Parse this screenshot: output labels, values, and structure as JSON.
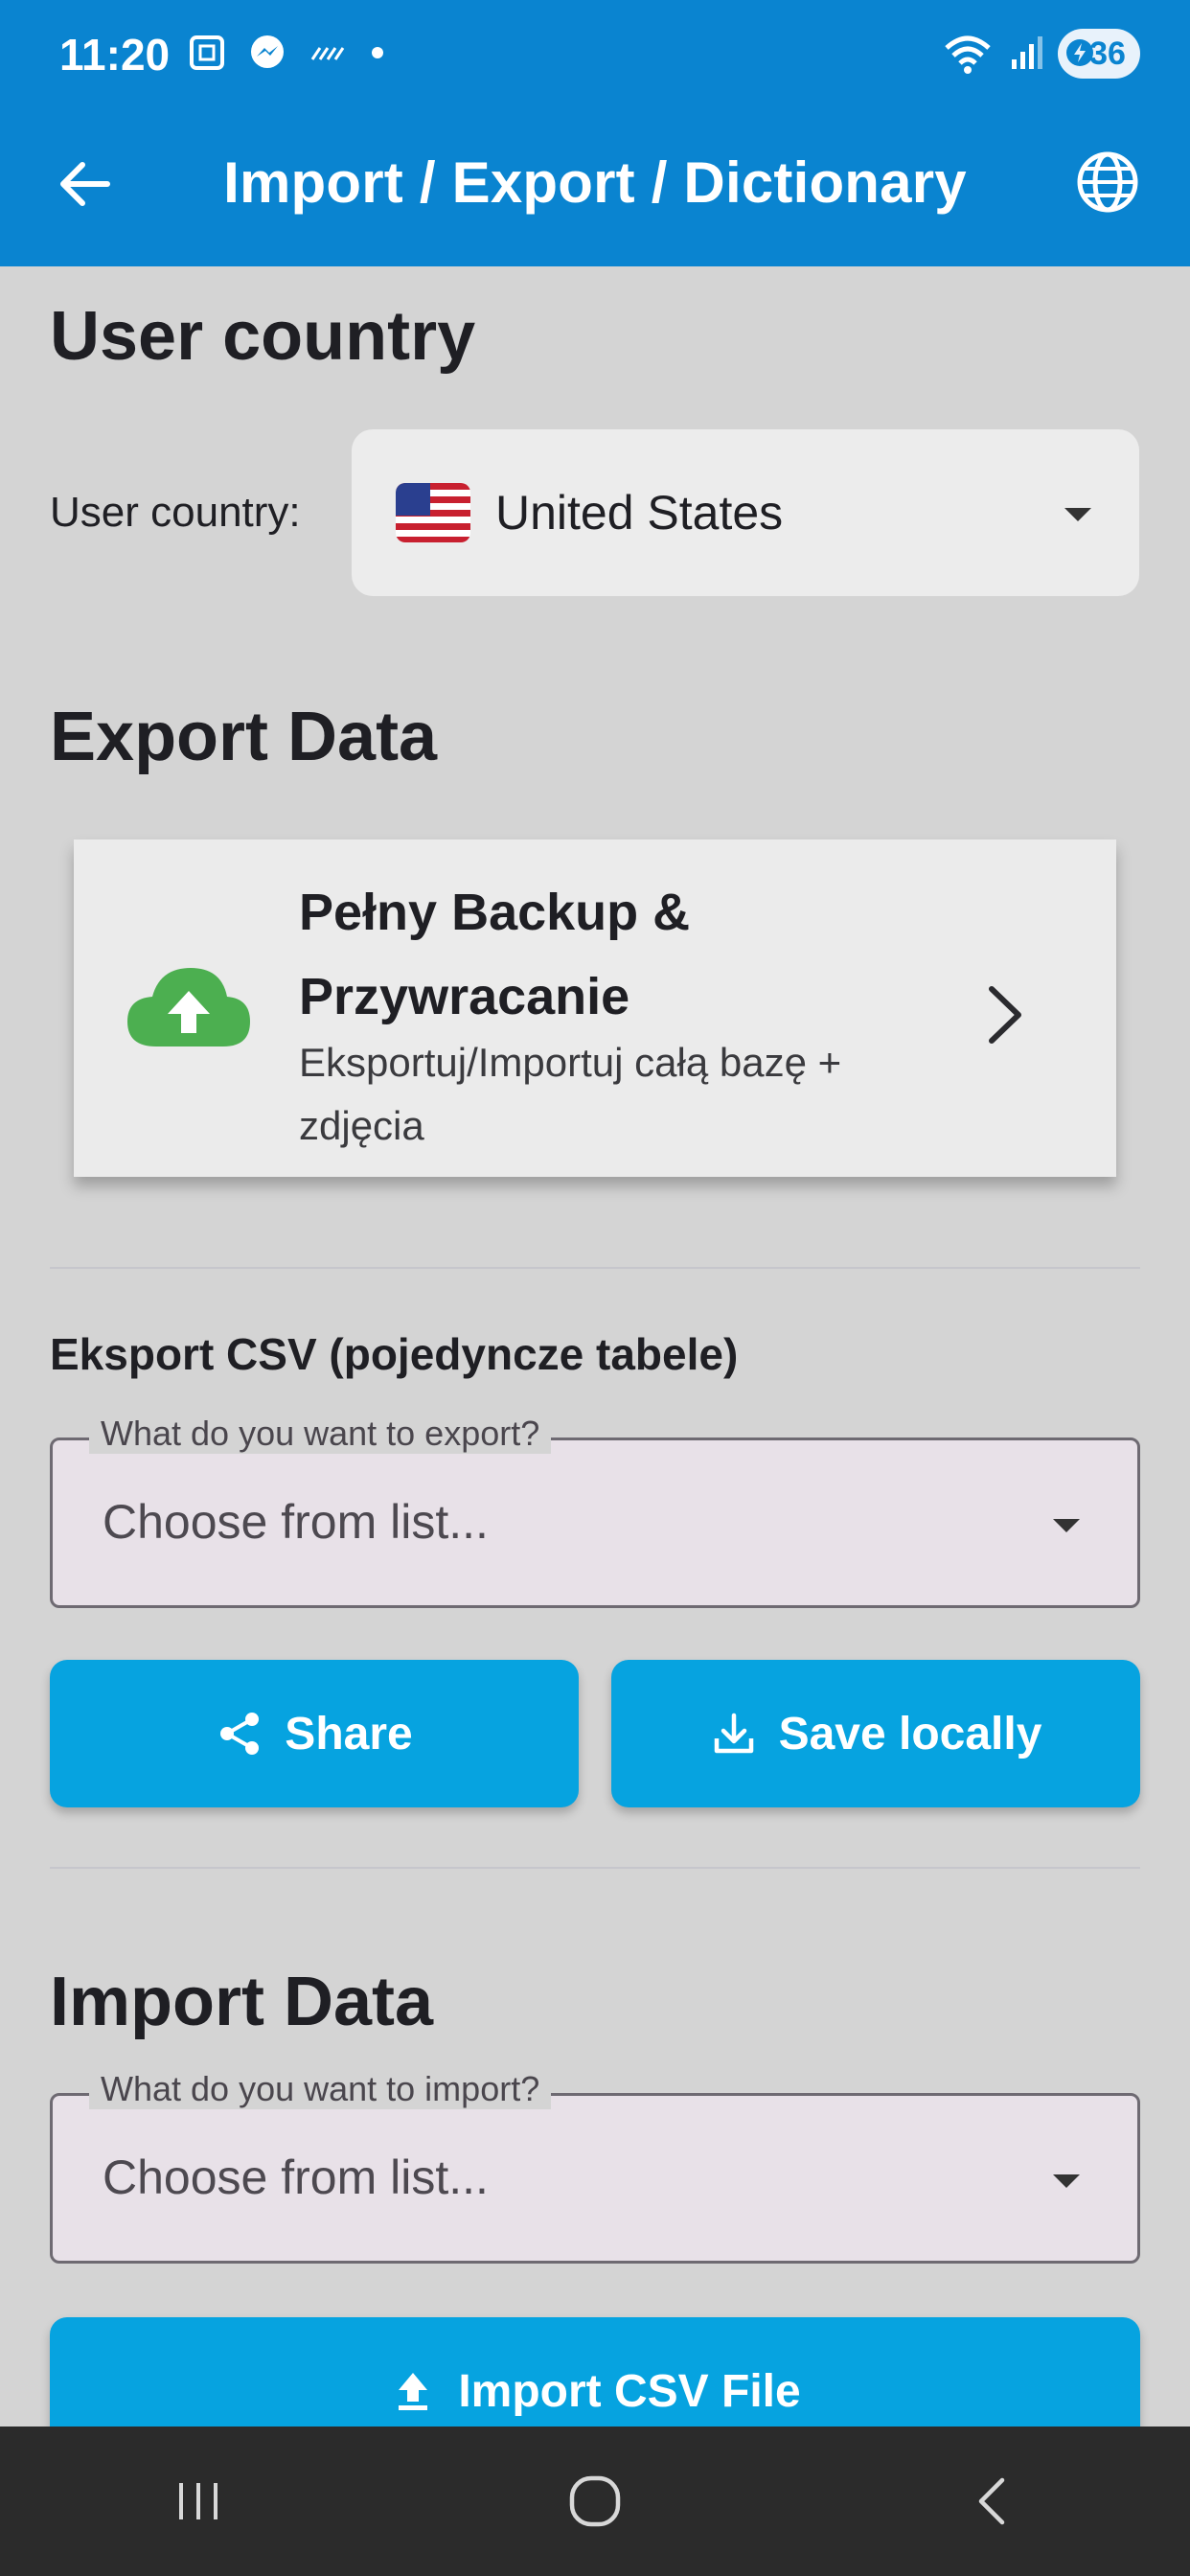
{
  "status_bar": {
    "time": "11:20",
    "battery": "36",
    "icons": [
      "screenshot-icon",
      "messenger-icon",
      "signal-activity-icon",
      "dot-icon",
      "wifi-icon",
      "cell-signal-icon",
      "battery-icon"
    ]
  },
  "app_bar": {
    "title": "Import / Export / Dictionary",
    "back_icon": "arrow-left-icon",
    "globe_icon": "globe-icon"
  },
  "user_country": {
    "heading": "User country",
    "label": "User country:",
    "selected": "United States",
    "flag_icon": "us-flag-icon"
  },
  "export": {
    "heading": "Export Data",
    "backup_card": {
      "title": "Pełny Backup & Przywracanie",
      "subtitle": "Eksportuj/Importuj całą bazę + zdjęcia",
      "icon": "cloud-upload-icon",
      "icon_color": "#4caf50"
    },
    "csv_heading": "Eksport CSV (pojedyncze tabele)",
    "field_label": "What do you want to export?",
    "field_placeholder": "Choose from list...",
    "share_label": "Share",
    "save_label": "Save locally"
  },
  "import": {
    "heading": "Import Data",
    "field_label": "What do you want to import?",
    "field_placeholder": "Choose from list...",
    "import_label": "Import CSV File"
  },
  "colors": {
    "app_bar": "#0a84d0",
    "button": "#06a3e0",
    "background": "#d4d4d4"
  }
}
